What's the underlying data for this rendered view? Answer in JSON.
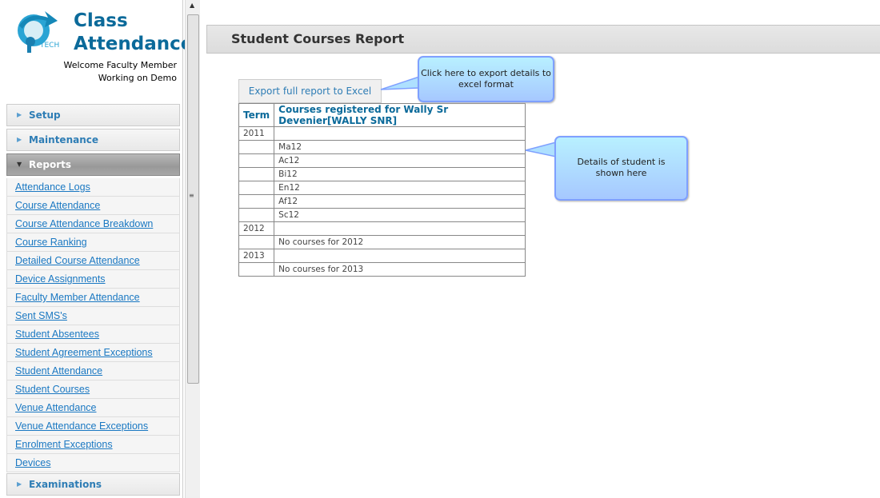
{
  "app": {
    "title_line1": "Class",
    "title_line2": "Attendance",
    "logo_text": "TECH",
    "welcome": "Welcome Faculty Member",
    "working_on": "Working on Demo"
  },
  "sidebar": {
    "sections": [
      {
        "label": "Setup",
        "open": false
      },
      {
        "label": "Maintenance",
        "open": false
      },
      {
        "label": "Reports",
        "open": true
      }
    ],
    "report_links": [
      "Attendance Logs",
      "Course Attendance",
      "Course Attendance Breakdown",
      "Course Ranking",
      "Detailed Course Attendance",
      "Device Assignments",
      "Faculty Member Attendance",
      "Sent SMS's",
      "Student Absentees",
      "Student Agreement Exceptions",
      "Student Attendance",
      "Student Courses",
      "Venue Attendance",
      "Venue Attendance Exceptions",
      "Enrolment Exceptions",
      "Devices"
    ],
    "last_section": {
      "label": "Examinations",
      "open": false
    }
  },
  "page": {
    "title": "Student Courses Report",
    "export_label": "Export full report to Excel"
  },
  "table": {
    "headers": [
      "Term",
      "Courses registered for Wally Sr Devenier[WALLY SNR]"
    ],
    "rows": [
      [
        "2011",
        ""
      ],
      [
        "",
        "Ma12"
      ],
      [
        "",
        "Ac12"
      ],
      [
        "",
        "Bi12"
      ],
      [
        "",
        "En12"
      ],
      [
        "",
        "Af12"
      ],
      [
        "",
        "Sc12"
      ],
      [
        "2012",
        ""
      ],
      [
        "",
        "No courses for 2012"
      ],
      [
        "2013",
        ""
      ],
      [
        "",
        "No courses for 2013"
      ]
    ]
  },
  "callouts": {
    "export": "Click here to export details to excel format",
    "details": "Details of student is shown here"
  },
  "colors": {
    "brand": "#0b6a9a",
    "link": "#1a78c2",
    "callout": "#b8f0ff"
  }
}
